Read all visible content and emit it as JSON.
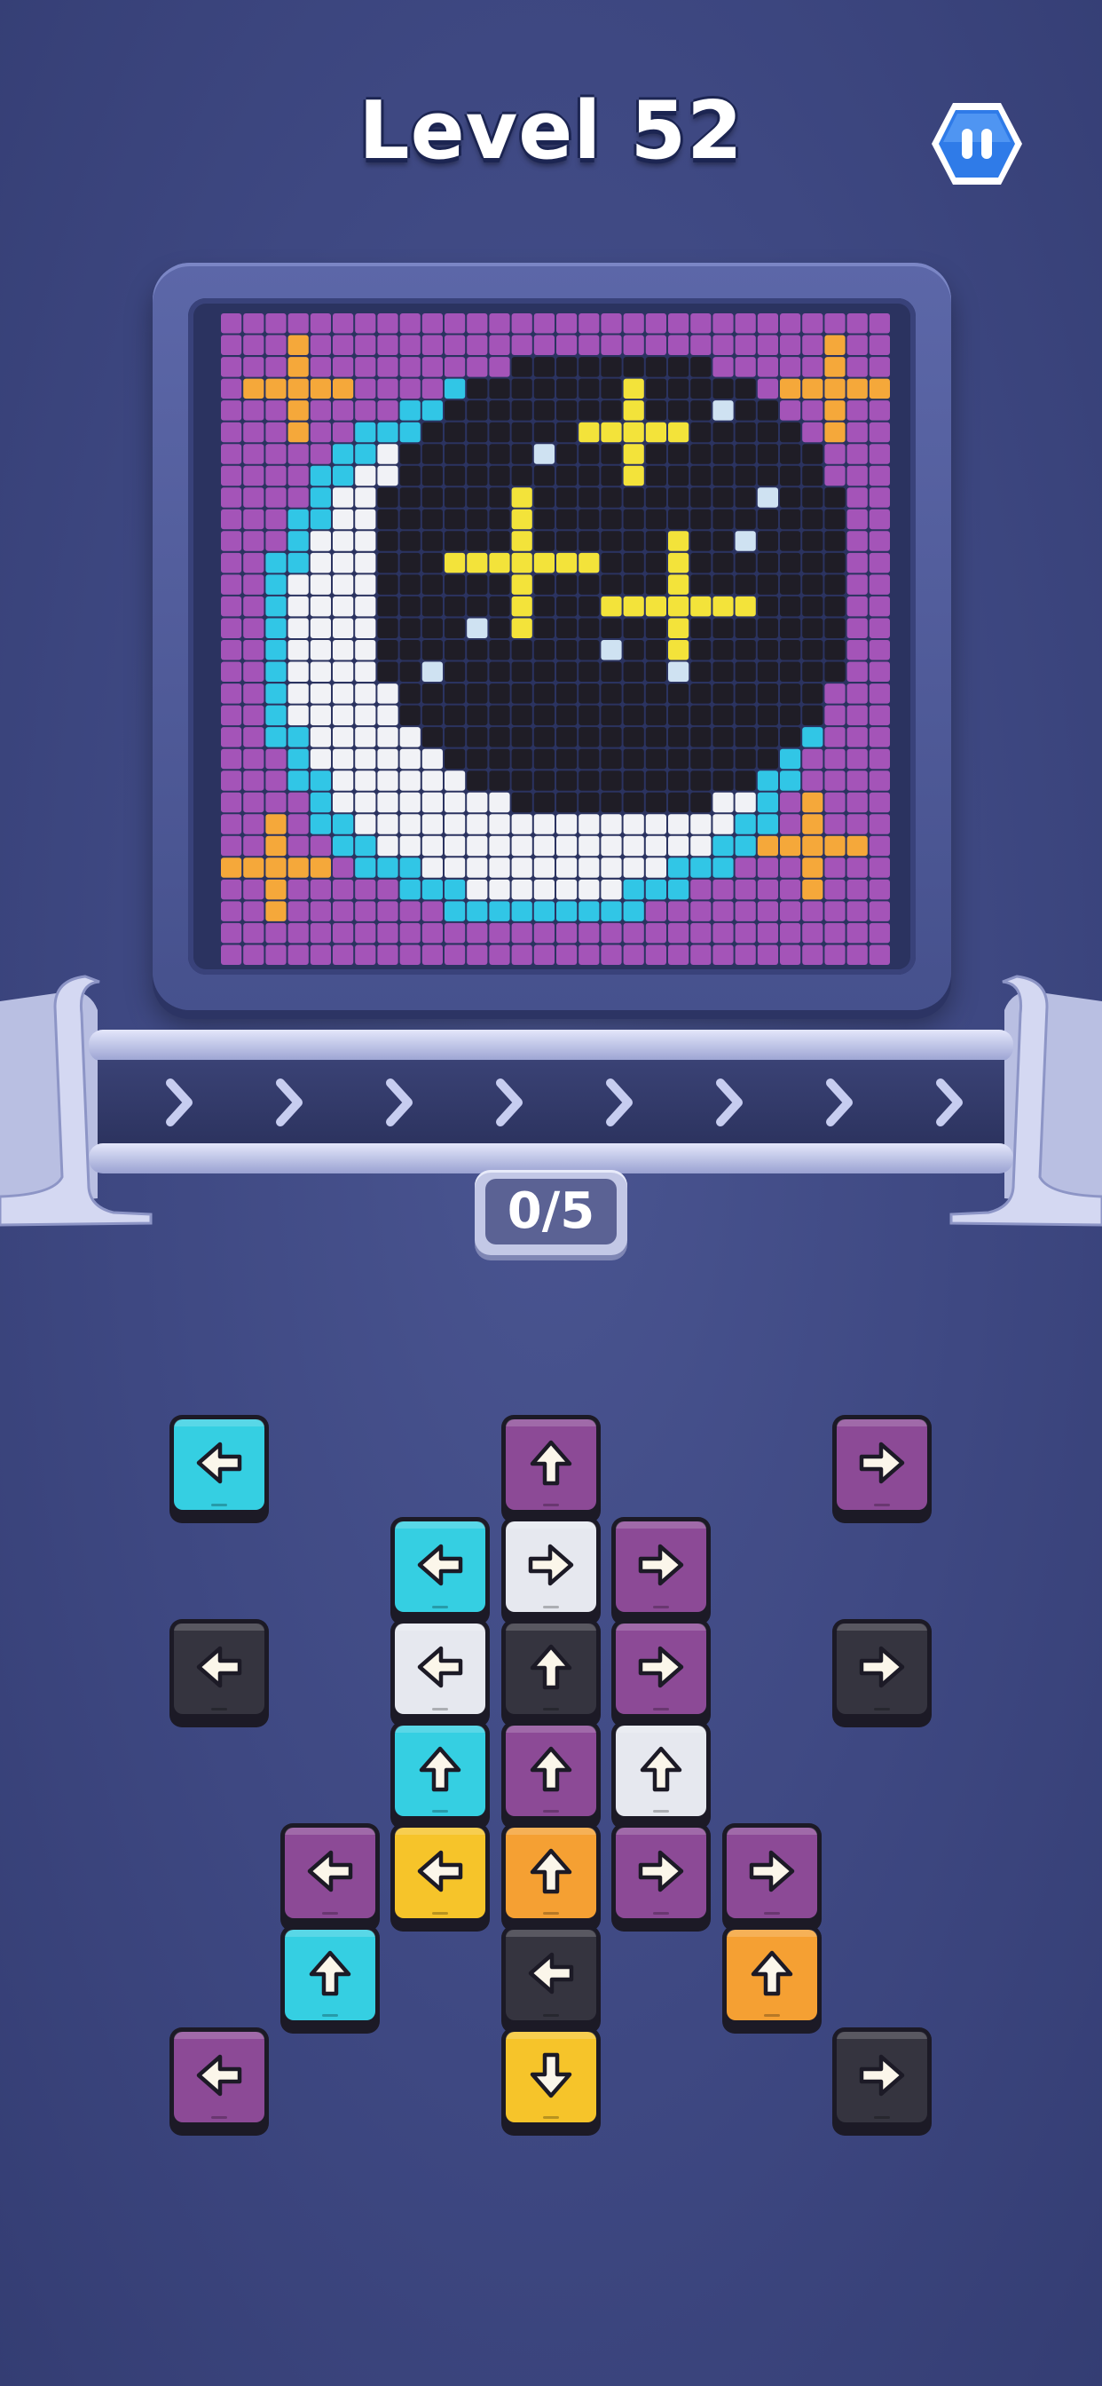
{
  "header": {
    "title": "Level 52"
  },
  "pause_button": {
    "icon": "pause-icon"
  },
  "progress": {
    "collected_text": "0/5"
  },
  "colors": {
    "cyan": "#35cfe2",
    "purple": "#8c4a96",
    "black": "#35343f",
    "white": "#e6e8ef",
    "yellow": "#f6c42a",
    "orange": "#f5a033"
  },
  "puzzle_image": {
    "icon": "crescent-moon-pixel-art"
  },
  "tiles": [
    {
      "col": 0,
      "row": 0,
      "color": "cyan",
      "dir": "left"
    },
    {
      "col": 3,
      "row": 0,
      "color": "purple",
      "dir": "up"
    },
    {
      "col": 6,
      "row": 0,
      "color": "purple",
      "dir": "right"
    },
    {
      "col": 2,
      "row": 1,
      "color": "cyan",
      "dir": "left"
    },
    {
      "col": 3,
      "row": 1,
      "color": "white",
      "dir": "right"
    },
    {
      "col": 4,
      "row": 1,
      "color": "purple",
      "dir": "right"
    },
    {
      "col": 0,
      "row": 2,
      "color": "black",
      "dir": "left"
    },
    {
      "col": 2,
      "row": 2,
      "color": "white",
      "dir": "left"
    },
    {
      "col": 3,
      "row": 2,
      "color": "black",
      "dir": "up"
    },
    {
      "col": 4,
      "row": 2,
      "color": "purple",
      "dir": "right"
    },
    {
      "col": 6,
      "row": 2,
      "color": "black",
      "dir": "right"
    },
    {
      "col": 2,
      "row": 3,
      "color": "cyan",
      "dir": "up"
    },
    {
      "col": 3,
      "row": 3,
      "color": "purple",
      "dir": "up"
    },
    {
      "col": 4,
      "row": 3,
      "color": "white",
      "dir": "up"
    },
    {
      "col": 1,
      "row": 4,
      "color": "purple",
      "dir": "left"
    },
    {
      "col": 2,
      "row": 4,
      "color": "yellow",
      "dir": "left"
    },
    {
      "col": 3,
      "row": 4,
      "color": "orange",
      "dir": "up"
    },
    {
      "col": 4,
      "row": 4,
      "color": "purple",
      "dir": "right"
    },
    {
      "col": 5,
      "row": 4,
      "color": "purple",
      "dir": "right"
    },
    {
      "col": 1,
      "row": 5,
      "color": "cyan",
      "dir": "up"
    },
    {
      "col": 3,
      "row": 5,
      "color": "black",
      "dir": "left"
    },
    {
      "col": 5,
      "row": 5,
      "color": "orange",
      "dir": "up"
    },
    {
      "col": 0,
      "row": 6,
      "color": "purple",
      "dir": "left"
    },
    {
      "col": 3,
      "row": 6,
      "color": "yellow",
      "dir": "down"
    },
    {
      "col": 6,
      "row": 6,
      "color": "black",
      "dir": "right"
    }
  ]
}
